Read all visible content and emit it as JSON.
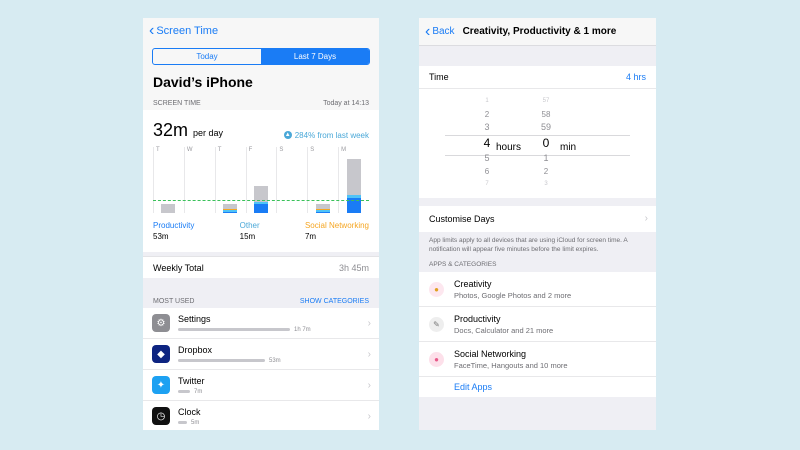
{
  "colors": {
    "accent": "#1a7cf5",
    "productivity": "#1a7cf5",
    "other": "#4fc3f7",
    "social": "#f5a623",
    "average_line": "#3ac15a"
  },
  "left": {
    "back_label": "Screen Time",
    "segments": [
      {
        "label": "Today",
        "active": false
      },
      {
        "label": "Last 7 Days",
        "active": true
      }
    ],
    "device": "David’s iPhone",
    "section_label": "SCREEN TIME",
    "section_time": "Today at 14:13",
    "average": {
      "value": "32m",
      "unit": "per day"
    },
    "trend": "284% from last week",
    "chart_data": {
      "type": "bar",
      "categories": [
        "T",
        "W",
        "T",
        "F",
        "S",
        "S",
        "M"
      ],
      "series": [
        {
          "name": "Productivity",
          "values": [
            0,
            0,
            1,
            7,
            0,
            1,
            11
          ]
        },
        {
          "name": "Other",
          "values": [
            0,
            0,
            1,
            1,
            0,
            1,
            2
          ]
        },
        {
          "name": "Social Networking",
          "values": [
            0,
            0,
            1,
            0,
            0,
            1,
            0
          ]
        },
        {
          "name": "Unlabeled",
          "values": [
            7,
            0,
            4,
            12,
            0,
            4,
            27
          ]
        }
      ],
      "average_line": 9
    },
    "legend": [
      {
        "label": "Productivity",
        "value": "53m"
      },
      {
        "label": "Other",
        "value": "15m"
      },
      {
        "label": "Social Networking",
        "value": "7m"
      }
    ],
    "weekly_total": {
      "label": "Weekly Total",
      "value": "3h 45m"
    },
    "most_used": {
      "label": "MOST USED",
      "link": "SHOW CATEGORIES"
    },
    "apps": [
      {
        "name": "Settings",
        "time": "1h 7m",
        "fraction": 1.0,
        "icon": "gear-icon"
      },
      {
        "name": "Dropbox",
        "time": "53m",
        "fraction": 0.78,
        "icon": "dropbox-icon"
      },
      {
        "name": "Twitter",
        "time": "7m",
        "fraction": 0.11,
        "icon": "bird-icon"
      },
      {
        "name": "Clock",
        "time": "5m",
        "fraction": 0.08,
        "icon": "clock-icon"
      }
    ]
  },
  "right": {
    "back_label": "Back",
    "title": "Creativity, Productivity & 1 more",
    "time_label": "Time",
    "time_value": "4 hrs",
    "hours_column": [
      "1",
      "2",
      "3",
      "4",
      "5",
      "6",
      "7"
    ],
    "minutes_column": [
      "57",
      "58",
      "59",
      "0",
      "1",
      "2",
      "3"
    ],
    "hours_unit": "hours",
    "minutes_unit": "min",
    "customise_days": "Customise Days",
    "note": "App limits apply to all devices that are using iCloud for screen time. A notification will appear five minutes before the limit expires.",
    "apps_header": "APPS & CATEGORIES",
    "categories": [
      {
        "name": "Creativity",
        "detail": "Photos, Google Photos and 2 more",
        "icon": "palette-icon"
      },
      {
        "name": "Productivity",
        "detail": "Docs, Calculator and 21 more",
        "icon": "pen-icon"
      },
      {
        "name": "Social Networking",
        "detail": "FaceTime, Hangouts and 10 more",
        "icon": "chat-bubbles-icon"
      }
    ],
    "edit_apps": "Edit Apps"
  }
}
